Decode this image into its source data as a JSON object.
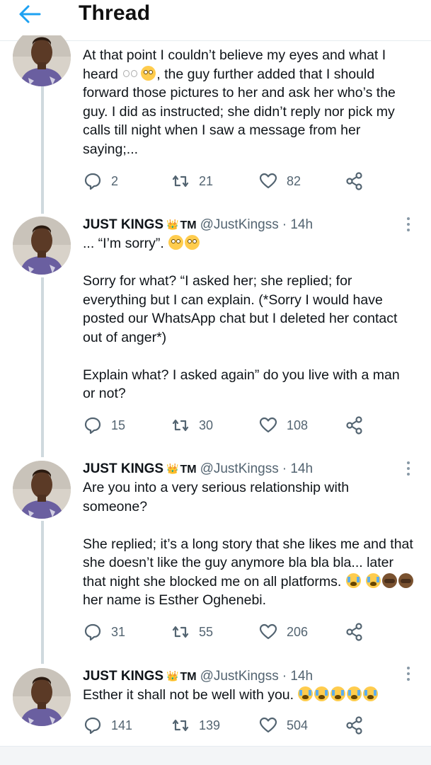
{
  "header": {
    "title": "Thread"
  },
  "tweets": [
    {
      "partial": true,
      "text": [
        [
          {
            "t": "At that point I couldn’t believe my eyes and what I heard "
          },
          {
            "e": "eyes"
          },
          {
            "e": "flushed"
          },
          {
            "t": ", the guy further added that I should forward those pictures to her and ask her who’s the guy. I did as instructed; she didn’t reply nor pick my calls till night when I saw a message from her saying;..."
          }
        ]
      ],
      "replies": "2",
      "retweets": "21",
      "likes": "82"
    },
    {
      "name": "JUST KINGS",
      "badge": "👑",
      "tm": "TM",
      "handle": "@JustKingss",
      "time": "· 14h",
      "text": [
        [
          {
            "t": "... “I’m sorry”. "
          },
          {
            "e": "flushed"
          },
          {
            "e": "flushed"
          }
        ],
        [
          {
            "t": "Sorry for what? “I asked her; she replied; for everything but I can explain. (*Sorry I would have posted our WhatsApp chat but I deleted her contact out of anger*)"
          }
        ],
        [
          {
            "t": "Explain what? I asked again” do you live with a man or not?"
          }
        ]
      ],
      "replies": "15",
      "retweets": "30",
      "likes": "108"
    },
    {
      "name": "JUST KINGS",
      "badge": "👑",
      "tm": "TM",
      "handle": "@JustKingss",
      "time": "· 14h",
      "text": [
        [
          {
            "t": "Are you into a very serious relationship with someone?"
          }
        ],
        [
          {
            "t": "She replied; it’s a long story that she likes me and that she doesn’t like the guy anymore bla bla bla... later that night she blocked me on all platforms. "
          },
          {
            "e": "sob"
          },
          {
            "t": " "
          },
          {
            "e": "sob"
          },
          {
            "e": "facepalm"
          },
          {
            "e": "facepalm"
          },
          {
            "t": " her name is Esther Oghenebi."
          }
        ]
      ],
      "replies": "31",
      "retweets": "55",
      "likes": "206"
    },
    {
      "name": "JUST KINGS",
      "badge": "👑",
      "tm": "TM",
      "handle": "@JustKingss",
      "time": "· 14h",
      "text": [
        [
          {
            "t": "Esther it shall not be well with you. "
          },
          {
            "e": "sob"
          },
          {
            "e": "sob"
          },
          {
            "e": "sob"
          },
          {
            "e": "sob"
          },
          {
            "e": "sob"
          }
        ]
      ],
      "replies": "141",
      "retweets": "139",
      "likes": "504"
    }
  ],
  "icons": {
    "back": "arrow-left-icon",
    "reply": "reply-icon",
    "retweet": "retweet-icon",
    "like": "heart-icon",
    "share": "share-icon",
    "more": "more-vertical-icon"
  },
  "colors": {
    "accent": "#1da1f2",
    "text": "#0f1419",
    "muted": "#536471",
    "thread_line": "#cfd9de"
  }
}
